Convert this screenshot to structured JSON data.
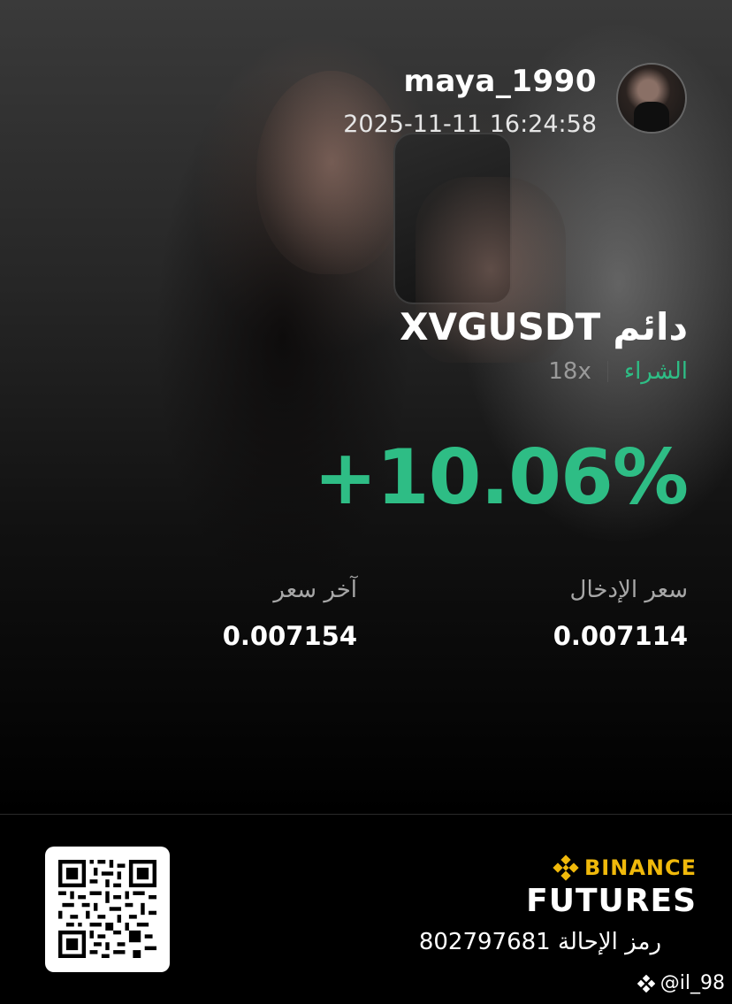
{
  "profile": {
    "username": "maya_1990",
    "timestamp": "2025-11-11 16:24:58"
  },
  "trade": {
    "pair": "XVGUSDT",
    "contract_type": "دائم",
    "side": "الشراء",
    "leverage": "18x",
    "pnl_percent": "+10.06%",
    "entry_label": "سعر الإدخال",
    "entry_price": "0.007114",
    "last_label": "آخر سعر",
    "last_price": "0.007154"
  },
  "brand": {
    "line1": "BINANCE",
    "line2": "FUTURES",
    "icon": "binance-diamond-icon",
    "color": "#f0b90b"
  },
  "referral": {
    "text": "رمز الإحالة 802797681"
  },
  "watermark": {
    "text": "@il_98"
  },
  "colors": {
    "positive": "#2ebd85",
    "background": "#000000",
    "text": "#ffffff",
    "muted": "#a7a7a7"
  }
}
